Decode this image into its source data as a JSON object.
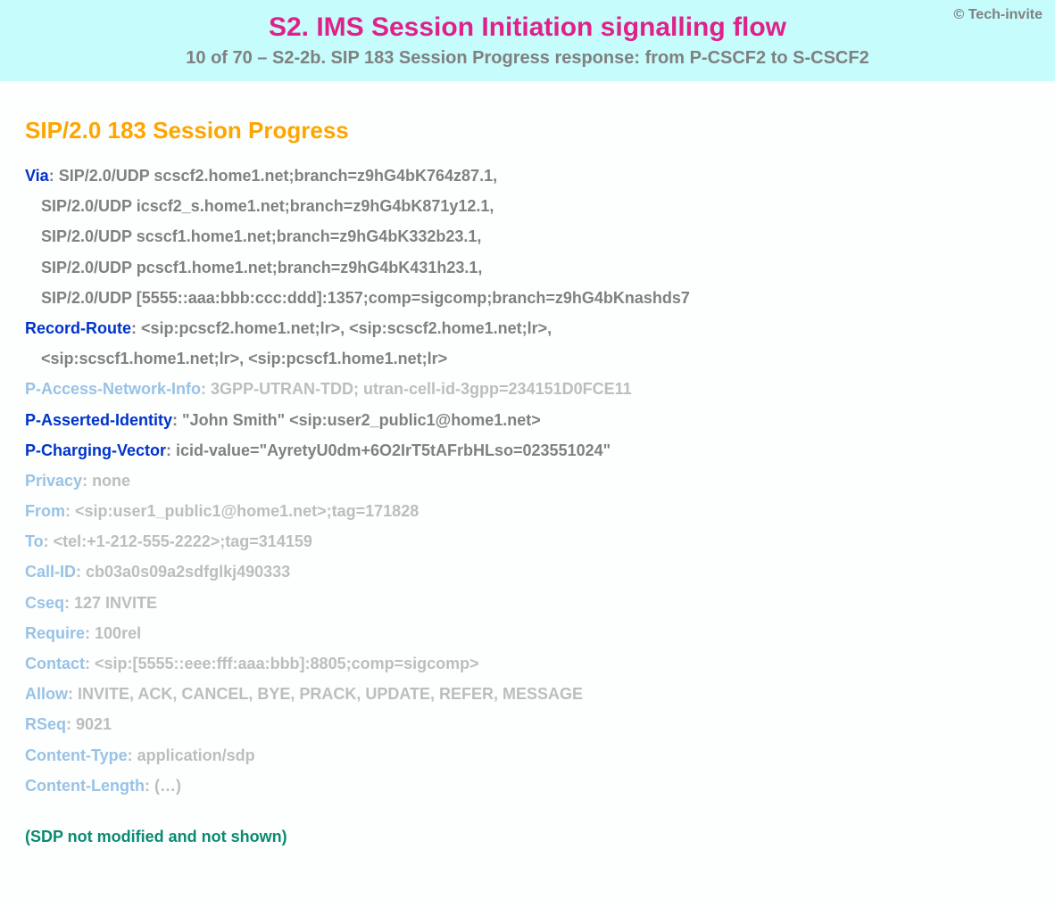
{
  "header": {
    "copyright": "© Tech-invite",
    "title": "S2. IMS Session Initiation signalling flow",
    "subtitle": "10 of 70 – S2-2b. SIP 183 Session Progress response: from P-CSCF2 to S-CSCF2"
  },
  "status_line": "SIP/2.0 183 Session Progress",
  "headers": [
    {
      "name": "Via",
      "style": "dark",
      "value": "SIP/2.0/UDP scscf2.home1.net;branch=z9hG4bK764z87.1,"
    },
    {
      "cont": true,
      "style": "dark",
      "value": "SIP/2.0/UDP icscf2_s.home1.net;branch=z9hG4bK871y12.1,"
    },
    {
      "cont": true,
      "style": "dark",
      "value": "SIP/2.0/UDP scscf1.home1.net;branch=z9hG4bK332b23.1,"
    },
    {
      "cont": true,
      "style": "dark",
      "value": "SIP/2.0/UDP pcscf1.home1.net;branch=z9hG4bK431h23.1,"
    },
    {
      "cont": true,
      "style": "dark",
      "value": "SIP/2.0/UDP [5555::aaa:bbb:ccc:ddd]:1357;comp=sigcomp;branch=z9hG4bKnashds7"
    },
    {
      "name": "Record-Route",
      "style": "dark",
      "value": "<sip:pcscf2.home1.net;lr>, <sip:scscf2.home1.net;lr>,"
    },
    {
      "cont": true,
      "style": "dark",
      "value": "<sip:scscf1.home1.net;lr>, <sip:pcscf1.home1.net;lr>"
    },
    {
      "name": "P-Access-Network-Info",
      "style": "light",
      "value": "3GPP-UTRAN-TDD; utran-cell-id-3gpp=234151D0FCE11"
    },
    {
      "name": "P-Asserted-Identity",
      "style": "dark",
      "value": "\"John Smith\" <sip:user2_public1@home1.net>"
    },
    {
      "name": "P-Charging-Vector",
      "style": "dark",
      "value": "icid-value=\"AyretyU0dm+6O2IrT5tAFrbHLso=023551024\""
    },
    {
      "name": "Privacy",
      "style": "light",
      "value": "none"
    },
    {
      "name": "From",
      "style": "light",
      "value": "<sip:user1_public1@home1.net>;tag=171828"
    },
    {
      "name": "To",
      "style": "light",
      "value": "<tel:+1-212-555-2222>;tag=314159"
    },
    {
      "name": "Call-ID",
      "style": "light",
      "value": "cb03a0s09a2sdfglkj490333"
    },
    {
      "name": "Cseq",
      "style": "light",
      "value": "127 INVITE"
    },
    {
      "name": "Require",
      "style": "light",
      "value": "100rel"
    },
    {
      "name": "Contact",
      "style": "light",
      "value": "<sip:[5555::eee:fff:aaa:bbb]:8805;comp=sigcomp>"
    },
    {
      "name": "Allow",
      "style": "light",
      "value": "INVITE, ACK, CANCEL, BYE, PRACK, UPDATE, REFER, MESSAGE"
    },
    {
      "name": "RSeq",
      "style": "light",
      "value": "9021"
    },
    {
      "name": "Content-Type",
      "style": "light",
      "value": "application/sdp"
    },
    {
      "name": "Content-Length",
      "style": "light",
      "value": "(…)"
    }
  ],
  "note": "(SDP not modified and not shown)"
}
